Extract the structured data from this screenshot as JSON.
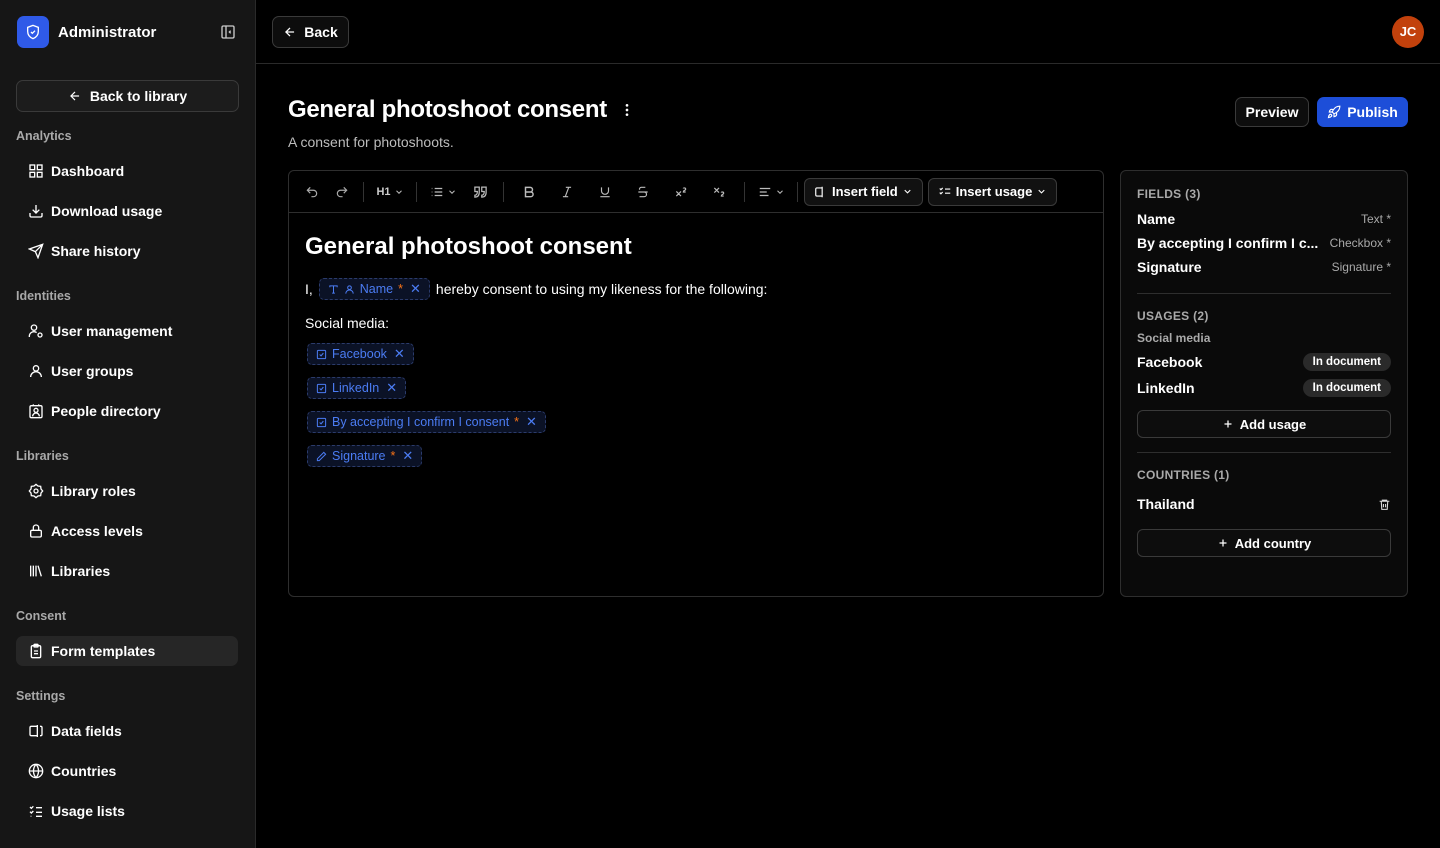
{
  "sidebar": {
    "brand": "Administrator",
    "back_to_library": "Back to library",
    "sections": [
      {
        "label": "Analytics",
        "items": [
          "Dashboard",
          "Download usage",
          "Share history"
        ]
      },
      {
        "label": "Identities",
        "items": [
          "User management",
          "User groups",
          "People directory"
        ]
      },
      {
        "label": "Libraries",
        "items": [
          "Library roles",
          "Access levels",
          "Libraries"
        ]
      },
      {
        "label": "Consent",
        "items": [
          "Form templates"
        ]
      },
      {
        "label": "Settings",
        "items": [
          "Data fields",
          "Countries",
          "Usage lists"
        ]
      }
    ],
    "active_item": "Form templates"
  },
  "topbar": {
    "back": "Back",
    "avatar_initials": "JC",
    "avatar_color": "#c2410c"
  },
  "header": {
    "title": "General photoshoot consent",
    "subtitle": "A consent for photoshoots.",
    "preview": "Preview",
    "publish": "Publish"
  },
  "toolbar": {
    "heading": "H1",
    "insert_field": "Insert field",
    "insert_usage": "Insert usage"
  },
  "editor": {
    "doc_title": "General photoshoot consent",
    "line_prefix": "I,",
    "name_chip": "Name",
    "line_suffix": "hereby consent to using my likeness for the following:",
    "social_label": "Social media:",
    "chips": [
      {
        "label": "Facebook",
        "required": false,
        "icon": "checkbox-icon"
      },
      {
        "label": "LinkedIn",
        "required": false,
        "icon": "checkbox-icon"
      },
      {
        "label": "By accepting I confirm I consent",
        "required": true,
        "icon": "checkbox-icon"
      },
      {
        "label": "Signature",
        "required": true,
        "icon": "pen-icon"
      }
    ],
    "required_mark": "*"
  },
  "panel": {
    "fields_header": "FIELDS (3)",
    "fields": [
      {
        "name": "Name",
        "type": "Text *"
      },
      {
        "name": "By accepting I confirm I c...",
        "type": "Checkbox *"
      },
      {
        "name": "Signature",
        "type": "Signature *"
      }
    ],
    "usages_header": "USAGES (2)",
    "usage_group": "Social media",
    "usages": [
      {
        "name": "Facebook",
        "badge": "In document"
      },
      {
        "name": "LinkedIn",
        "badge": "In document"
      }
    ],
    "add_usage": "Add usage",
    "countries_header": "COUNTRIES (1)",
    "countries": [
      "Thailand"
    ],
    "add_country": "Add country"
  }
}
